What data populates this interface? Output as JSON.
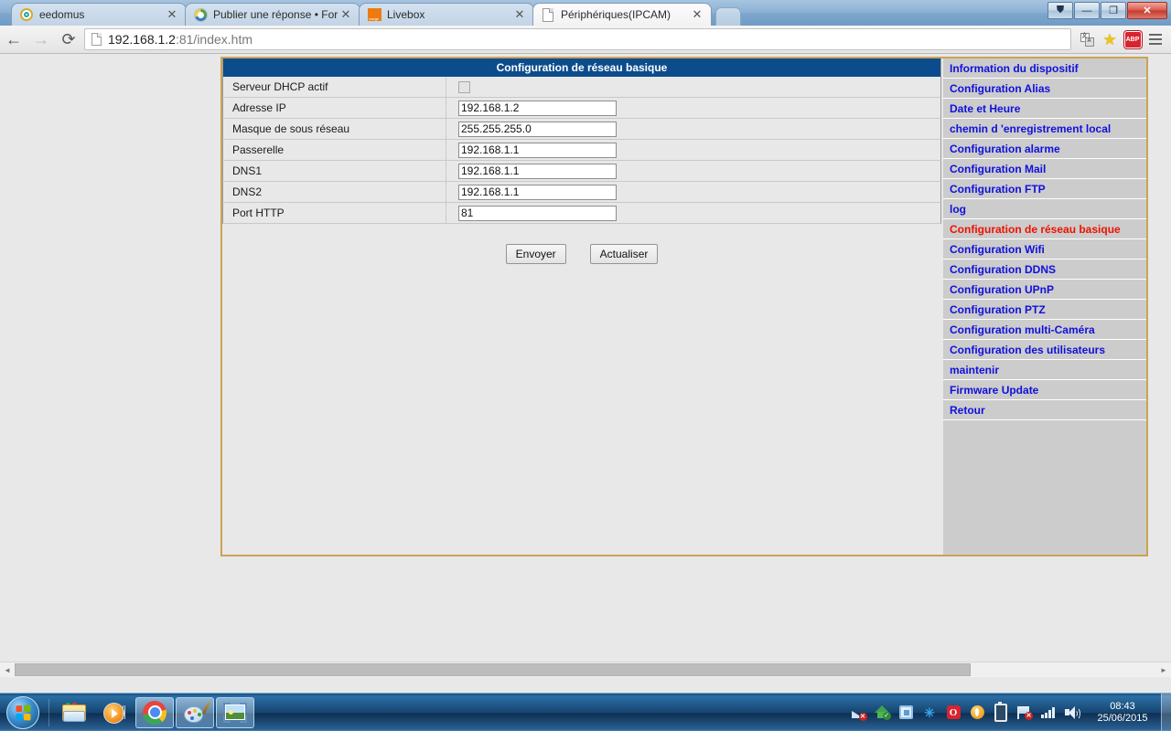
{
  "browser": {
    "tabs": [
      {
        "title": "eedomus",
        "icon": "eedomus-ring-icon",
        "active": false
      },
      {
        "title": "Publier une réponse • For",
        "icon": "forum-q-icon",
        "active": false
      },
      {
        "title": "Livebox",
        "icon": "orange-square-icon",
        "active": false
      },
      {
        "title": "Périphériques(IPCAM)",
        "icon": "page-icon",
        "active": true
      }
    ],
    "close_glyph": "✕",
    "window_controls": {
      "user": "⛊",
      "minimize": "—",
      "maximize": "❐",
      "close": "✕"
    },
    "nav": {
      "back": "←",
      "forward": "→",
      "reload": "⟳"
    },
    "address": {
      "host": "192.168.1.2",
      "rest": ":81/index.htm",
      "full": "192.168.1.2:81/index.htm"
    },
    "toolbar_icons": [
      {
        "name": "translate-icon",
        "label": "A"
      },
      {
        "name": "bookmark-star-icon",
        "label": "★"
      },
      {
        "name": "adblock-plus-icon",
        "label": "ABP"
      },
      {
        "name": "chrome-menu-icon",
        "label": "☰"
      }
    ]
  },
  "page": {
    "table": {
      "title": "Configuration de réseau basique",
      "rows": [
        {
          "label": "Serveur DHCP actif",
          "type": "checkbox",
          "value": "",
          "checked": false
        },
        {
          "label": "Adresse IP",
          "type": "text",
          "value": "192.168.1.2"
        },
        {
          "label": "Masque de sous réseau",
          "type": "text",
          "value": "255.255.255.0"
        },
        {
          "label": "Passerelle",
          "type": "text",
          "value": "192.168.1.1"
        },
        {
          "label": "DNS1",
          "type": "text",
          "value": "192.168.1.1"
        },
        {
          "label": "DNS2",
          "type": "text",
          "value": "192.168.1.1"
        },
        {
          "label": "Port HTTP",
          "type": "text",
          "value": "81"
        }
      ]
    },
    "buttons": {
      "submit": "Envoyer",
      "refresh": "Actualiser"
    },
    "sidebar": {
      "items": [
        {
          "label": "Information du dispositif",
          "active": false
        },
        {
          "label": "Configuration Alias",
          "active": false
        },
        {
          "label": "Date et Heure",
          "active": false
        },
        {
          "label": "chemin d  'enregistrement local",
          "active": false
        },
        {
          "label": "Configuration alarme",
          "active": false
        },
        {
          "label": "Configuration Mail",
          "active": false
        },
        {
          "label": "Configuration FTP",
          "active": false
        },
        {
          "label": "log",
          "active": false
        },
        {
          "label": "Configuration de réseau basique",
          "active": true
        },
        {
          "label": "Configuration Wifi",
          "active": false
        },
        {
          "label": "Configuration DDNS",
          "active": false
        },
        {
          "label": "Configuration UPnP",
          "active": false
        },
        {
          "label": "Configuration PTZ",
          "active": false
        },
        {
          "label": "Configuration multi-Caméra",
          "active": false
        },
        {
          "label": "Configuration des utilisateurs",
          "active": false
        },
        {
          "label": "maintenir",
          "active": false
        },
        {
          "label": "Firmware Update",
          "active": false
        },
        {
          "label": "Retour",
          "active": false
        }
      ]
    },
    "colors": {
      "title_bar": "#0d4c8c",
      "frame_border": "#cca352",
      "sidebar_bg": "#cccccc",
      "link": "#1010dd",
      "link_active": "#ee1100"
    },
    "scroll": {
      "left_arrow": "◄",
      "right_arrow": "►"
    }
  },
  "taskbar": {
    "start": "start-orb",
    "pinned": [
      {
        "name": "windows-explorer",
        "running": false
      },
      {
        "name": "windows-media-player",
        "running": false
      },
      {
        "name": "google-chrome",
        "running": true
      },
      {
        "name": "paint",
        "running": true
      },
      {
        "name": "photo-viewer",
        "running": true
      }
    ],
    "tray": [
      {
        "name": "network-disconnected-icon"
      },
      {
        "name": "security-home-icon"
      },
      {
        "name": "display-icon"
      },
      {
        "name": "bluetooth-icon",
        "glyph": "✳"
      },
      {
        "name": "opera-icon",
        "glyph": "O"
      },
      {
        "name": "antivirus-icon"
      },
      {
        "name": "battery-icon"
      },
      {
        "name": "network-flag-error-icon"
      },
      {
        "name": "signal-strength-icon"
      },
      {
        "name": "volume-icon"
      }
    ],
    "clock": {
      "time": "08:43",
      "date": "25/06/2015"
    }
  }
}
